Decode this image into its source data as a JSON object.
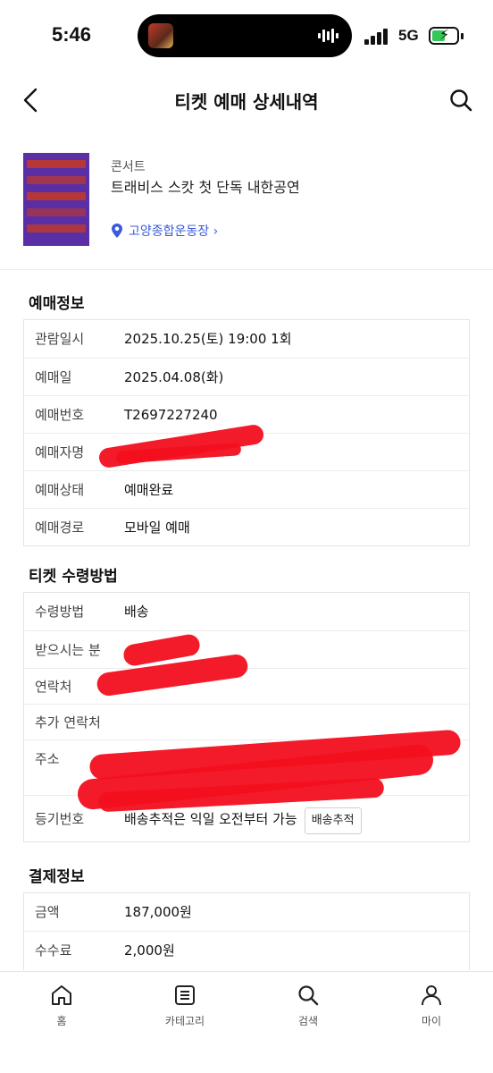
{
  "status_bar": {
    "time": "5:46",
    "network": "5G"
  },
  "header": {
    "title": "티켓 예매 상세내역"
  },
  "event": {
    "category": "콘서트",
    "title": "트래비스 스캇 첫 단독 내한공연",
    "venue": "고양종합운동장 ›"
  },
  "booking_info": {
    "title": "예매정보",
    "rows": [
      {
        "label": "관람일시",
        "value": "2025.10.25(토) 19:00 1회"
      },
      {
        "label": "예매일",
        "value": "2025.04.08(화)"
      },
      {
        "label": "예매번호",
        "value": "T2697227240"
      },
      {
        "label": "예매자명",
        "value": ""
      },
      {
        "label": "예매상태",
        "value": "예매완료"
      },
      {
        "label": "예매경로",
        "value": "모바일 예매"
      }
    ]
  },
  "receipt_method": {
    "title": "티켓 수령방법",
    "rows": [
      {
        "label": "수령방법",
        "value": "배송"
      },
      {
        "label": "받으시는 분",
        "value": ""
      },
      {
        "label": "연락처",
        "value": ""
      },
      {
        "label": "추가 연락처",
        "value": ""
      },
      {
        "label": "주소",
        "value": ""
      },
      {
        "label": "등기번호",
        "value": "배송추적은 익일 오전부터 가능",
        "button": "배송추적"
      }
    ]
  },
  "payment_info": {
    "title": "결제정보",
    "rows": [
      {
        "label": "금액",
        "value": "187,000원"
      },
      {
        "label": "수수료",
        "value": "2,000원"
      }
    ]
  },
  "bottom_nav": [
    {
      "label": "홈",
      "icon": "home-icon"
    },
    {
      "label": "카테고리",
      "icon": "category-icon"
    },
    {
      "label": "검색",
      "icon": "search-icon"
    },
    {
      "label": "마이",
      "icon": "person-icon"
    }
  ],
  "colors": {
    "accent": "#3b5bdb",
    "redaction": "#f20f1e",
    "poster": "#5a2fa5"
  }
}
